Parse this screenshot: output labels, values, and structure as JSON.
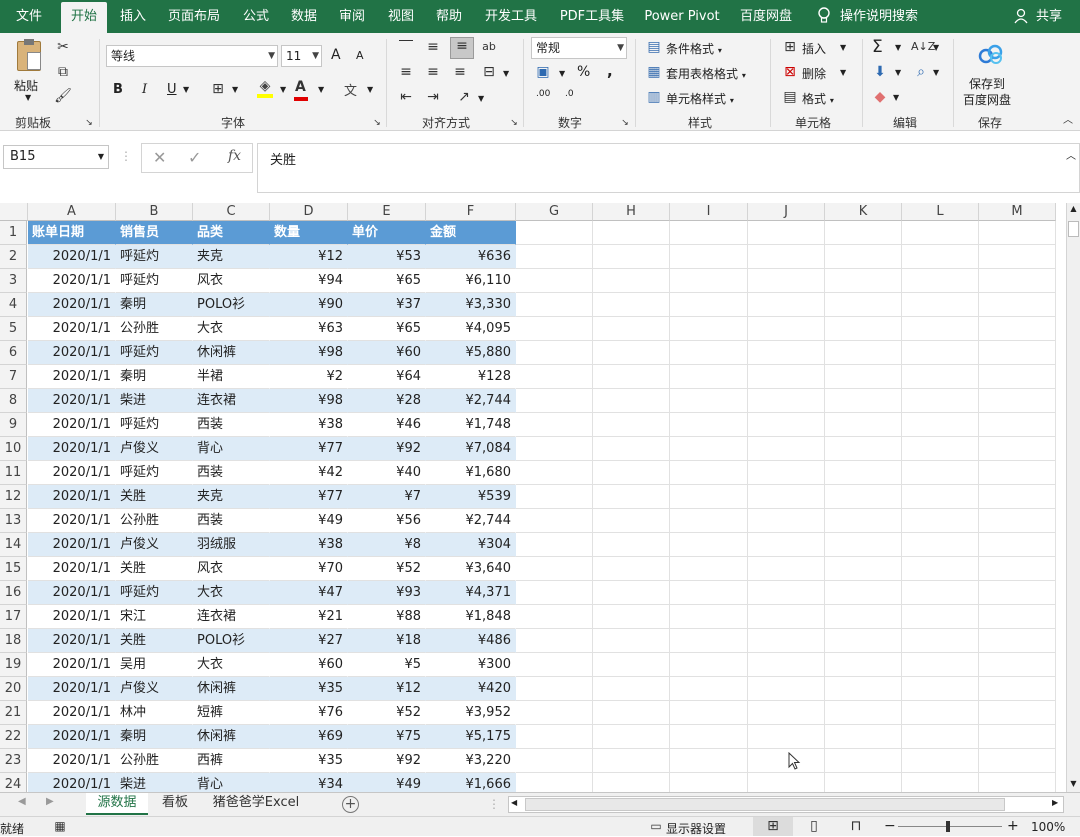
{
  "tabs": [
    {
      "label": "文件"
    },
    {
      "label": "开始"
    },
    {
      "label": "插入"
    },
    {
      "label": "页面布局"
    },
    {
      "label": "公式"
    },
    {
      "label": "数据"
    },
    {
      "label": "审阅"
    },
    {
      "label": "视图"
    },
    {
      "label": "帮助"
    },
    {
      "label": "开发工具"
    },
    {
      "label": "PDF工具集"
    },
    {
      "label": "Power Pivot"
    },
    {
      "label": "百度网盘"
    }
  ],
  "tell_me": "操作说明搜索",
  "share": "共享",
  "ribbon": {
    "clipboard": {
      "label": "剪贴板",
      "paste": "粘贴"
    },
    "font": {
      "label": "字体",
      "name": "等线",
      "size": "11",
      "bold": "B",
      "italic": "I",
      "underline": "U",
      "grow": "A",
      "shrink": "A",
      "font_color": "A",
      "phonetic": "文"
    },
    "alignment": {
      "label": "对齐方式"
    },
    "number": {
      "label": "数字",
      "format": "常规",
      "percent": "%",
      "comma": ",",
      "inc_dec": ".00",
      "dec_dec": ".0"
    },
    "styles": {
      "label": "样式",
      "conditional": "条件格式",
      "table": "套用表格格式",
      "cell_styles": "单元格样式"
    },
    "cells": {
      "label": "单元格",
      "insert": "插入",
      "delete": "删除",
      "format": "格式"
    },
    "editing": {
      "label": "编辑",
      "sum": "Σ"
    },
    "save": {
      "label": "保存",
      "btn_line1": "保存到",
      "btn_line2": "百度网盘"
    }
  },
  "formula_bar": {
    "name_box": "B15",
    "fx": "fx",
    "value": "关胜"
  },
  "columns": [
    "A",
    "B",
    "C",
    "D",
    "E",
    "F",
    "G",
    "H",
    "I",
    "J",
    "K",
    "L",
    "M"
  ],
  "header_row": [
    "账单日期",
    "销售员",
    "品类",
    "数量",
    "单价",
    "金额"
  ],
  "rows": [
    [
      "2020/1/1",
      "呼延灼",
      "夹克",
      "¥12",
      "¥53",
      "¥636"
    ],
    [
      "2020/1/1",
      "呼延灼",
      "风衣",
      "¥94",
      "¥65",
      "¥6,110"
    ],
    [
      "2020/1/1",
      "秦明",
      "POLO衫",
      "¥90",
      "¥37",
      "¥3,330"
    ],
    [
      "2020/1/1",
      "公孙胜",
      "大衣",
      "¥63",
      "¥65",
      "¥4,095"
    ],
    [
      "2020/1/1",
      "呼延灼",
      "休闲裤",
      "¥98",
      "¥60",
      "¥5,880"
    ],
    [
      "2020/1/1",
      "秦明",
      "半裙",
      "¥2",
      "¥64",
      "¥128"
    ],
    [
      "2020/1/1",
      "柴进",
      "连衣裙",
      "¥98",
      "¥28",
      "¥2,744"
    ],
    [
      "2020/1/1",
      "呼延灼",
      "西装",
      "¥38",
      "¥46",
      "¥1,748"
    ],
    [
      "2020/1/1",
      "卢俊义",
      "背心",
      "¥77",
      "¥92",
      "¥7,084"
    ],
    [
      "2020/1/1",
      "呼延灼",
      "西装",
      "¥42",
      "¥40",
      "¥1,680"
    ],
    [
      "2020/1/1",
      "关胜",
      "夹克",
      "¥77",
      "¥7",
      "¥539"
    ],
    [
      "2020/1/1",
      "公孙胜",
      "西装",
      "¥49",
      "¥56",
      "¥2,744"
    ],
    [
      "2020/1/1",
      "卢俊义",
      "羽绒服",
      "¥38",
      "¥8",
      "¥304"
    ],
    [
      "2020/1/1",
      "关胜",
      "风衣",
      "¥70",
      "¥52",
      "¥3,640"
    ],
    [
      "2020/1/1",
      "呼延灼",
      "大衣",
      "¥47",
      "¥93",
      "¥4,371"
    ],
    [
      "2020/1/1",
      "宋江",
      "连衣裙",
      "¥21",
      "¥88",
      "¥1,848"
    ],
    [
      "2020/1/1",
      "关胜",
      "POLO衫",
      "¥27",
      "¥18",
      "¥486"
    ],
    [
      "2020/1/1",
      "吴用",
      "大衣",
      "¥60",
      "¥5",
      "¥300"
    ],
    [
      "2020/1/1",
      "卢俊义",
      "休闲裤",
      "¥35",
      "¥12",
      "¥420"
    ],
    [
      "2020/1/1",
      "林冲",
      "短裤",
      "¥76",
      "¥52",
      "¥3,952"
    ],
    [
      "2020/1/1",
      "秦明",
      "休闲裤",
      "¥69",
      "¥75",
      "¥5,175"
    ],
    [
      "2020/1/1",
      "公孙胜",
      "西裤",
      "¥35",
      "¥92",
      "¥3,220"
    ],
    [
      "2020/1/1",
      "柴进",
      "背心",
      "¥34",
      "¥49",
      "¥1,666"
    ]
  ],
  "sheets": [
    {
      "label": "源数据"
    },
    {
      "label": "看板"
    },
    {
      "label": "猪爸爸学Excel"
    }
  ],
  "status": {
    "ready": "就绪",
    "display_settings": "显示器设置",
    "zoom": "100%"
  },
  "colors": {
    "accent": "#217346",
    "table_header": "#5b9bd5",
    "band": "#ddebf7"
  }
}
